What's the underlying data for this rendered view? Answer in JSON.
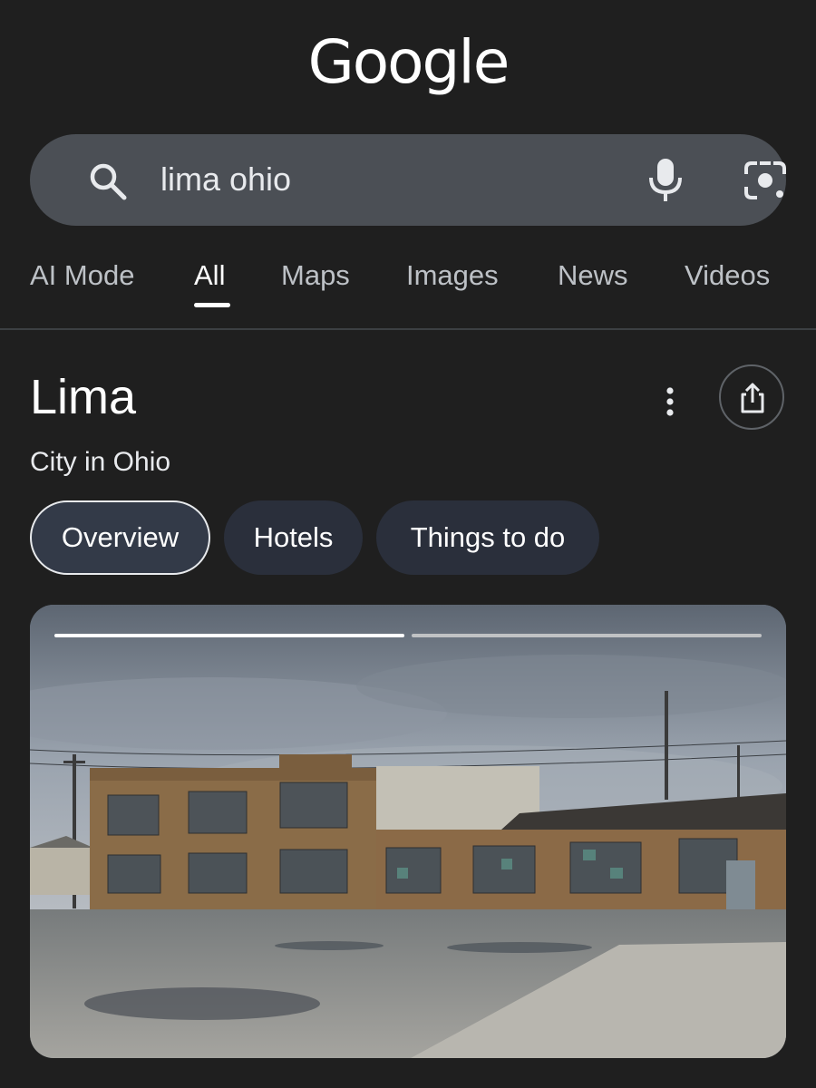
{
  "logo": "Google",
  "search": {
    "query": "lima ohio",
    "search_icon": "search-icon",
    "voice_icon": "mic-icon",
    "lens_icon": "camera-lens-icon"
  },
  "tabs": [
    {
      "label": "AI Mode"
    },
    {
      "label": "All",
      "active": true
    },
    {
      "label": "Maps"
    },
    {
      "label": "Images"
    },
    {
      "label": "News"
    },
    {
      "label": "Videos"
    }
  ],
  "knowledge_panel": {
    "title": "Lima",
    "subtitle": "City in Ohio",
    "more_icon": "more-vert-icon",
    "share_icon": "share-icon",
    "chips": [
      {
        "label": "Overview",
        "selected": true
      },
      {
        "label": "Hotels"
      },
      {
        "label": "Things to do"
      }
    ],
    "photo": {
      "slide_count": 2,
      "current_slide": 1
    }
  },
  "colors": {
    "background": "#1f1f1f",
    "search_box": "#4b4f55",
    "chip": "#2a2f3b",
    "chip_selected": "#333a48",
    "text": "#e8eaed"
  }
}
